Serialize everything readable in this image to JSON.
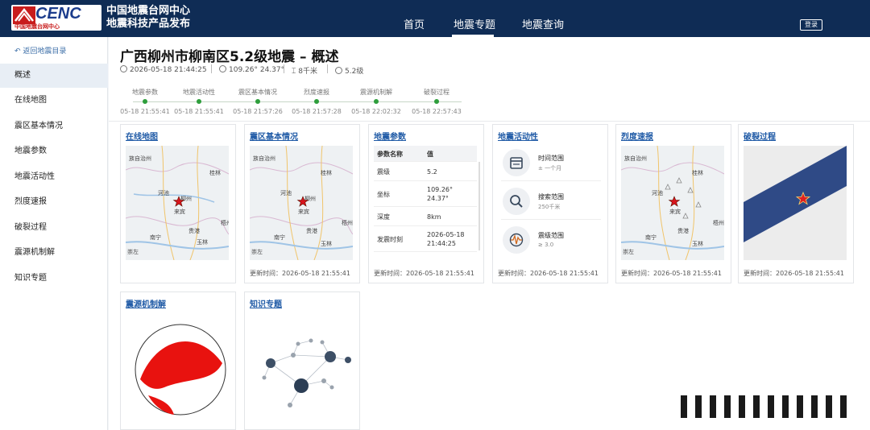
{
  "header": {
    "logo_text": "CENC",
    "logo_sub": "中国地震台网中心",
    "site_title_line1": "中国地震台网中心",
    "site_title_line2": "地震科技产品发布",
    "nav": [
      "首页",
      "地震专题",
      "地震查询"
    ],
    "nav_active": "地震专题",
    "login_label": "登录"
  },
  "sidebar": {
    "back_label": "返回地震目录",
    "items": [
      "概述",
      "在线地图",
      "震区基本情况",
      "地震参数",
      "地震活动性",
      "烈度速报",
      "破裂过程",
      "震源机制解",
      "知识专题"
    ],
    "active": "概述"
  },
  "event": {
    "title": "广西柳州市柳南区5.2级地震 – 概述",
    "time": "2026-05-18 21:44:25",
    "coords": "109.26° 24.37°",
    "depth": "8千米",
    "magnitude": "5.2级"
  },
  "timeline": [
    {
      "label": "地震参数",
      "time": "05-18 21:55:41"
    },
    {
      "label": "地震活动性",
      "time": "05-18 21:55:41"
    },
    {
      "label": "震区基本情况",
      "time": "05-18 21:57:26"
    },
    {
      "label": "烈度速报",
      "time": "05-18 21:57:28"
    },
    {
      "label": "震源机制解",
      "time": "05-18 22:02:32"
    },
    {
      "label": "破裂过程",
      "time": "05-18 22:57:43"
    }
  ],
  "cards": {
    "online_map": {
      "title": "在线地图"
    },
    "zone_info": {
      "title": "震区基本情况",
      "updated": "更新时间：2026-05-18 21:55:41"
    },
    "params": {
      "title": "地震参数",
      "head_key": "参数名称",
      "head_val": "值",
      "rows": [
        {
          "k": "震级",
          "v": "5.2"
        },
        {
          "k": "坐标",
          "v": "109.26°\n24.37°"
        },
        {
          "k": "深度",
          "v": "8km"
        },
        {
          "k": "发震时刻",
          "v": "2026-05-18\n21:44:25"
        }
      ],
      "updated": "更新时间：2026-05-18 21:55:41"
    },
    "activity": {
      "title": "地震活动性",
      "items": [
        {
          "k": "时间范围",
          "v": "± 一个月",
          "icon": "calendar-icon"
        },
        {
          "k": "搜索范围",
          "v": "250千米",
          "icon": "search-icon"
        },
        {
          "k": "震级范围",
          "v": "≥ 3.0",
          "icon": "seismic-wave-icon"
        }
      ],
      "updated": "更新时间：2026-05-18 21:55:41"
    },
    "intensity": {
      "title": "烈度速报",
      "updated": "更新时间：2026-05-18 21:55:41"
    },
    "rupture": {
      "title": "破裂过程",
      "updated": "更新时间：2026-05-18 21:55:41"
    },
    "focal": {
      "title": "震源机制解"
    },
    "knowledge": {
      "title": "知识专题"
    }
  },
  "map_labels": [
    "族自治州",
    "河池",
    "桂林",
    "柳州",
    "来宾",
    "南宁",
    "贵港",
    "梧州",
    "玉林",
    "崇左"
  ],
  "colors": {
    "header_bg": "#0f2c55",
    "link": "#1f5aa6",
    "timeline_dot": "#2e9e3c",
    "rupture_band": "#2f4a86",
    "epicenter": "#e02020",
    "beachball": "#e8120f"
  }
}
